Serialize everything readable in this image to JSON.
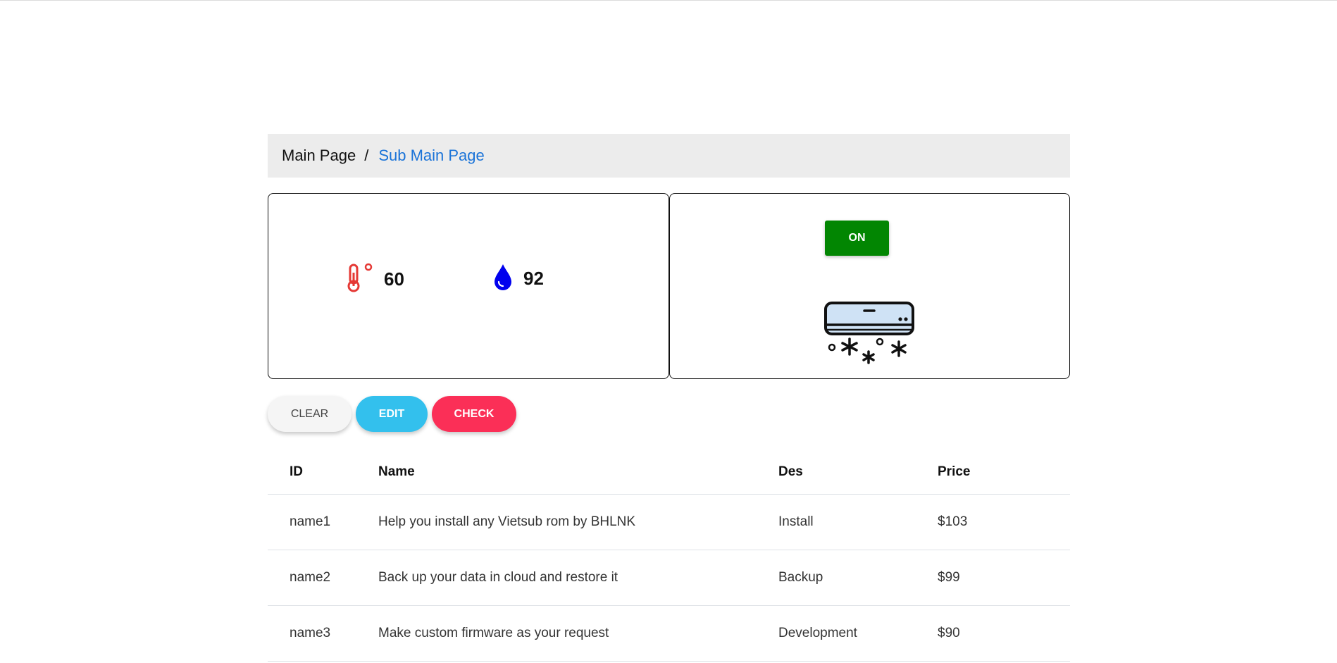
{
  "breadcrumb": {
    "main": "Main Page",
    "separator": "/",
    "sub": "Sub Main Page"
  },
  "sensors": {
    "temperature": {
      "icon": "thermometer-icon",
      "value": "60",
      "color": "#e53935"
    },
    "humidity": {
      "icon": "water-drop-icon",
      "value": "92",
      "color": "#0000ee"
    }
  },
  "device": {
    "power_label": "ON",
    "power_color": "#028602",
    "icon": "air-conditioner-icon"
  },
  "actions": {
    "clear_label": "CLEAR",
    "edit_label": "EDIT",
    "check_label": "CHECK"
  },
  "table": {
    "headers": [
      "ID",
      "Name",
      "Des",
      "Price"
    ],
    "rows": [
      [
        "name1",
        "Help you install any Vietsub rom by BHLNK",
        "Install",
        "$103"
      ],
      [
        "name2",
        "Back up your data in cloud and restore it",
        "Backup",
        "$99"
      ],
      [
        "name3",
        "Make custom firmware as your request",
        "Development",
        "$90"
      ]
    ]
  }
}
